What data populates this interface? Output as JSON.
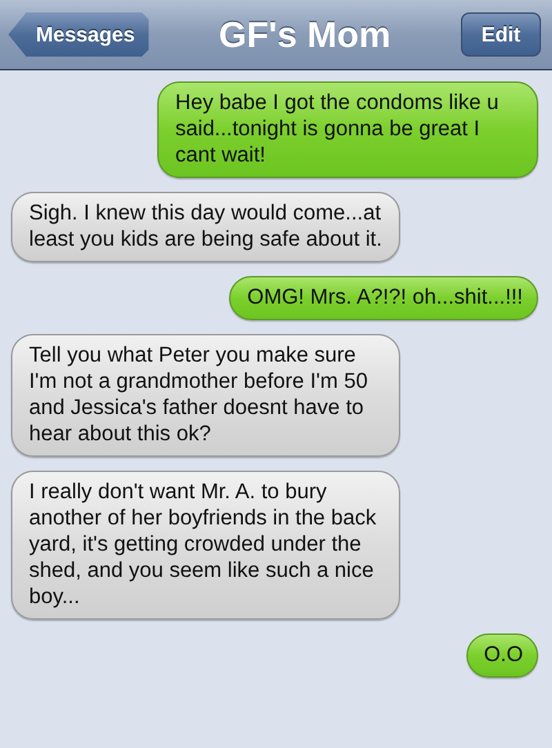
{
  "nav_bar": {
    "back_button": "Messages",
    "title": "GF's Mom",
    "edit_button": "Edit"
  },
  "messages": [
    {
      "kind": "sent",
      "text": "Hey babe I got the condoms like u said...tonight is gonna be great I cant wait!"
    },
    {
      "kind": "received",
      "text": "Sigh. I knew this day would come...at least you kids are being safe about it."
    },
    {
      "kind": "sent",
      "text": "OMG! Mrs. A?!?! oh...shit...!!!"
    },
    {
      "kind": "received",
      "text": "Tell you what Peter you make sure I'm not a grandmother before I'm 50 and Jessica's father doesnt have to hear about this ok?"
    },
    {
      "kind": "received",
      "text": "I really don't want Mr. A. to bury another of her boyfriends in the back yard, it's getting crowded under the shed, and you seem like such a nice boy..."
    },
    {
      "kind": "sent",
      "text": "O.O"
    }
  ]
}
